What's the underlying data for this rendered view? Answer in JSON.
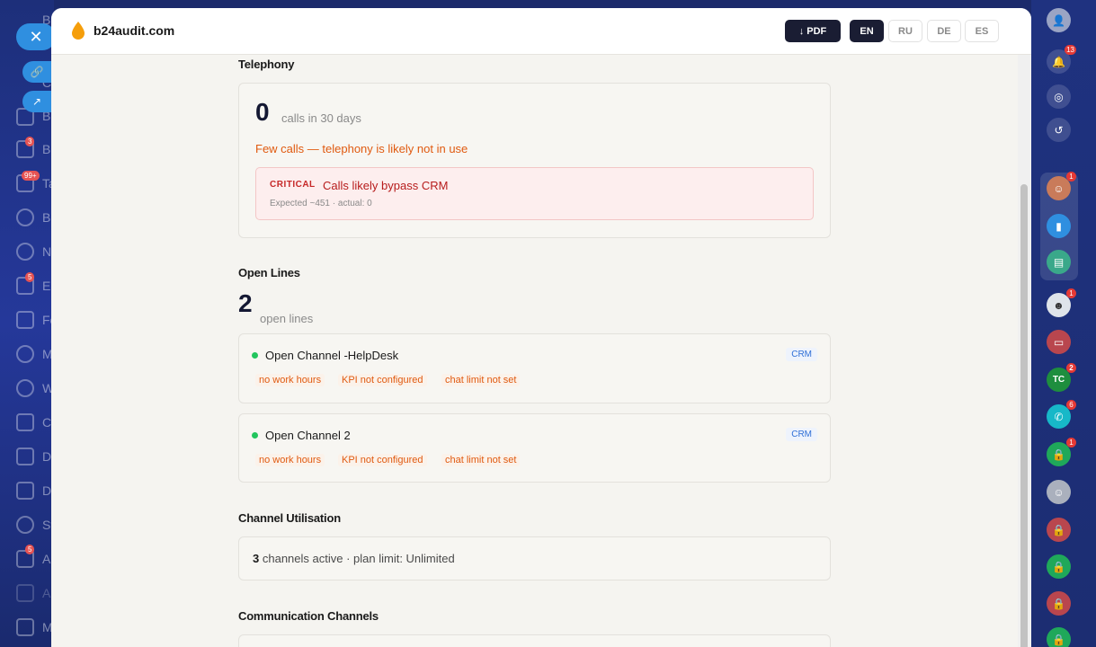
{
  "header": {
    "brand": "b24audit.com",
    "pdf_label": "↓ PDF",
    "languages": [
      {
        "code": "EN",
        "active": true
      },
      {
        "code": "RU",
        "active": false
      },
      {
        "code": "DE",
        "active": false
      },
      {
        "code": "ES",
        "active": false
      }
    ]
  },
  "telephony": {
    "title": "Telephony",
    "calls_count": "0",
    "calls_label": "calls in 30 days",
    "warning": "Few calls — telephony is likely not in use",
    "critical_tag": "CRITICAL",
    "critical_msg": "Calls likely bypass CRM",
    "critical_sub": "Expected ~451 · actual: 0"
  },
  "open_lines": {
    "title": "Open Lines",
    "count": "2",
    "count_label": "open lines",
    "channels": [
      {
        "name": "Open Channel -HelpDesk",
        "badge": "CRM",
        "tags": [
          "no work hours",
          "KPI not configured",
          "chat limit not set"
        ]
      },
      {
        "name": "Open Channel 2",
        "badge": "CRM",
        "tags": [
          "no work hours",
          "KPI not configured",
          "chat limit not set"
        ]
      }
    ]
  },
  "utilisation": {
    "title": "Channel Utilisation",
    "active_count": "3",
    "text": "channels active · plan limit: Unlimited"
  },
  "communication": {
    "title": "Communication Channels"
  },
  "colors": {
    "accent_dark": "#1a1d33",
    "warning": "#e05a10",
    "critical": "#c62828",
    "online": "#22c55e",
    "crm_badge": "#2f6fd6"
  },
  "right_bar": {
    "badges": [
      "13",
      "1",
      "1",
      "2",
      "6",
      "1"
    ]
  },
  "left_bar": {
    "labels": [
      "Bo",
      "C",
      "Bo",
      "Bo",
      "Ta",
      "Bo",
      "N",
      "Er",
      "Fe",
      "M",
      "W",
      "C",
      "D",
      "D",
      "St",
      "A",
      "A",
      "M"
    ],
    "badges": [
      "3",
      "99+",
      "5",
      "5"
    ]
  }
}
